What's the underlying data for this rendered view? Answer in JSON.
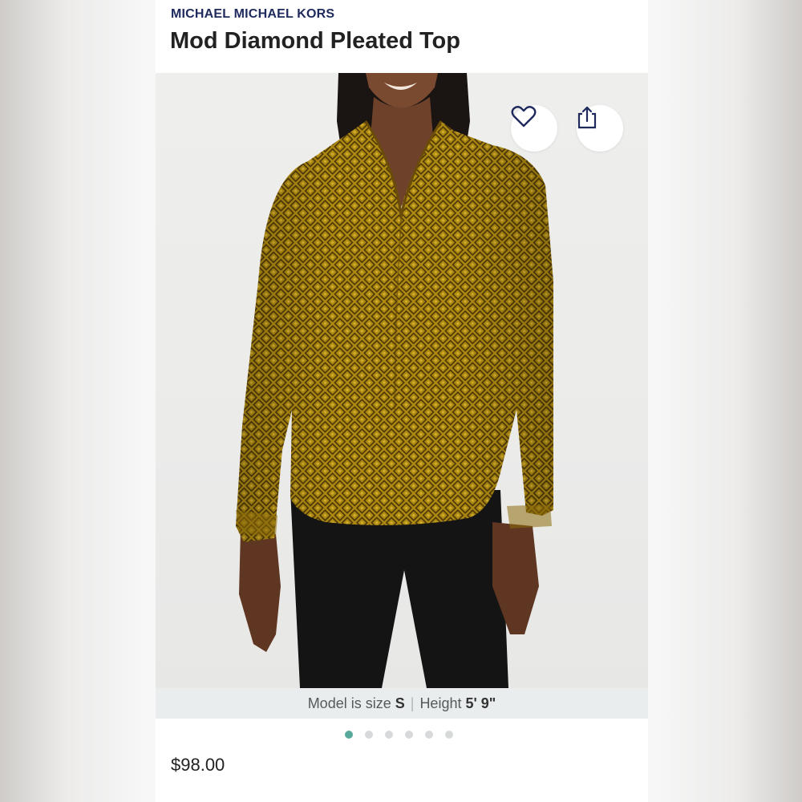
{
  "product": {
    "brand": "MICHAEL MICHAEL KORS",
    "title": "Mod Diamond Pleated Top",
    "price": "$98.00"
  },
  "model_info": {
    "size_label": "Model is size",
    "size_value": "S",
    "height_label": "Height",
    "height_value": "5' 9\""
  },
  "carousel": {
    "total": 6,
    "active_index": 0
  },
  "icons": {
    "favorite": "heart-icon",
    "share": "share-icon"
  },
  "colors": {
    "brand": "#1f2a5c",
    "active_dot": "#58a89b",
    "blouse": "#a9860f"
  }
}
